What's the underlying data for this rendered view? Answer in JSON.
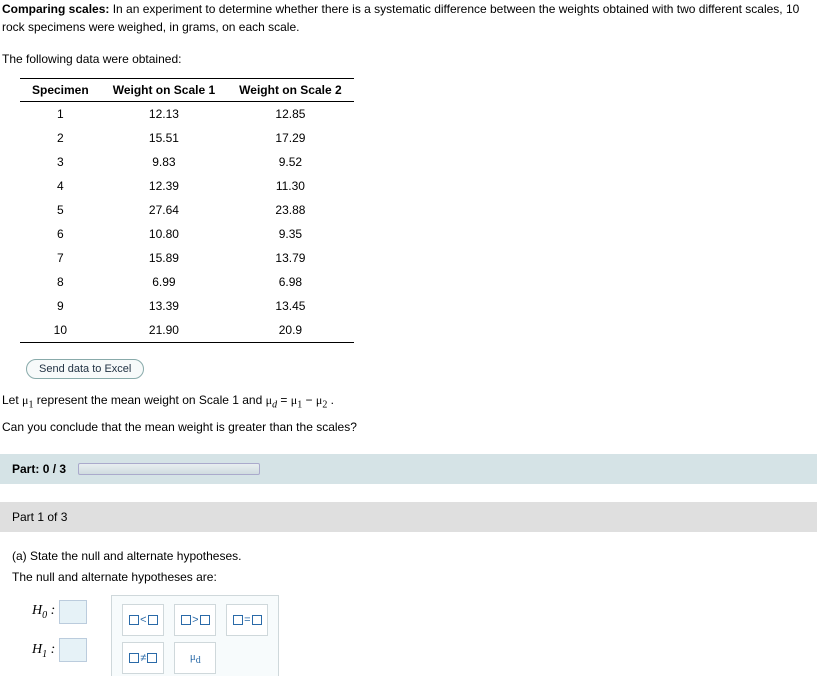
{
  "intro": {
    "bold_lead": "Comparing scales:",
    "lead_rest": " In an experiment to determine whether there is a systematic difference between the weights obtained with two different scales, 10 rock specimens were weighed, in grams, on each scale.",
    "following": "The following data were obtained:"
  },
  "table": {
    "headers": {
      "c1": "Specimen",
      "c2": "Weight on Scale 1",
      "c3": "Weight on Scale 2"
    },
    "rows": [
      {
        "spec": "1",
        "w1": "12.13",
        "w2": "12.85"
      },
      {
        "spec": "2",
        "w1": "15.51",
        "w2": "17.29"
      },
      {
        "spec": "3",
        "w1": "9.83",
        "w2": "9.52"
      },
      {
        "spec": "4",
        "w1": "12.39",
        "w2": "11.30"
      },
      {
        "spec": "5",
        "w1": "27.64",
        "w2": "23.88"
      },
      {
        "spec": "6",
        "w1": "10.80",
        "w2": "9.35"
      },
      {
        "spec": "7",
        "w1": "15.89",
        "w2": "13.79"
      },
      {
        "spec": "8",
        "w1": "6.99",
        "w2": "6.98"
      },
      {
        "spec": "9",
        "w1": "13.39",
        "w2": "13.45"
      },
      {
        "spec": "10",
        "w1": "21.90",
        "w2": "20.9"
      }
    ]
  },
  "send_button": "Send data to Excel",
  "let_line": {
    "prefix": "Let ",
    "mu1": "μ",
    "mu1_sub": "1",
    "mid": " represent the mean weight on Scale 1 and ",
    "mud": "μ",
    "mud_sub": "d",
    "eq": " = ",
    "mu_a": "μ",
    "mu_a_sub": "1",
    "minus": " − ",
    "mu_b": "μ",
    "mu_b_sub": "2",
    "end": " ."
  },
  "question": "Can you conclude that the mean weight is greater than the scales?",
  "progress": {
    "label_prefix": "Part: ",
    "value": "0 / 3"
  },
  "part_header": "Part 1 of 3",
  "part_body": {
    "a_line": "(a) State the null and alternate hypotheses.",
    "sub_line": "The null and alternate hypotheses are:"
  },
  "hypotheses": {
    "h0": "H",
    "h0_sub": "0",
    "colon": " :",
    "h1": "H",
    "h1_sub": "1"
  },
  "palette": {
    "lt": "<",
    "gt": ">",
    "eq": "=",
    "ne": "≠",
    "mud_label": "μ",
    "mud_label_sub": "d"
  }
}
